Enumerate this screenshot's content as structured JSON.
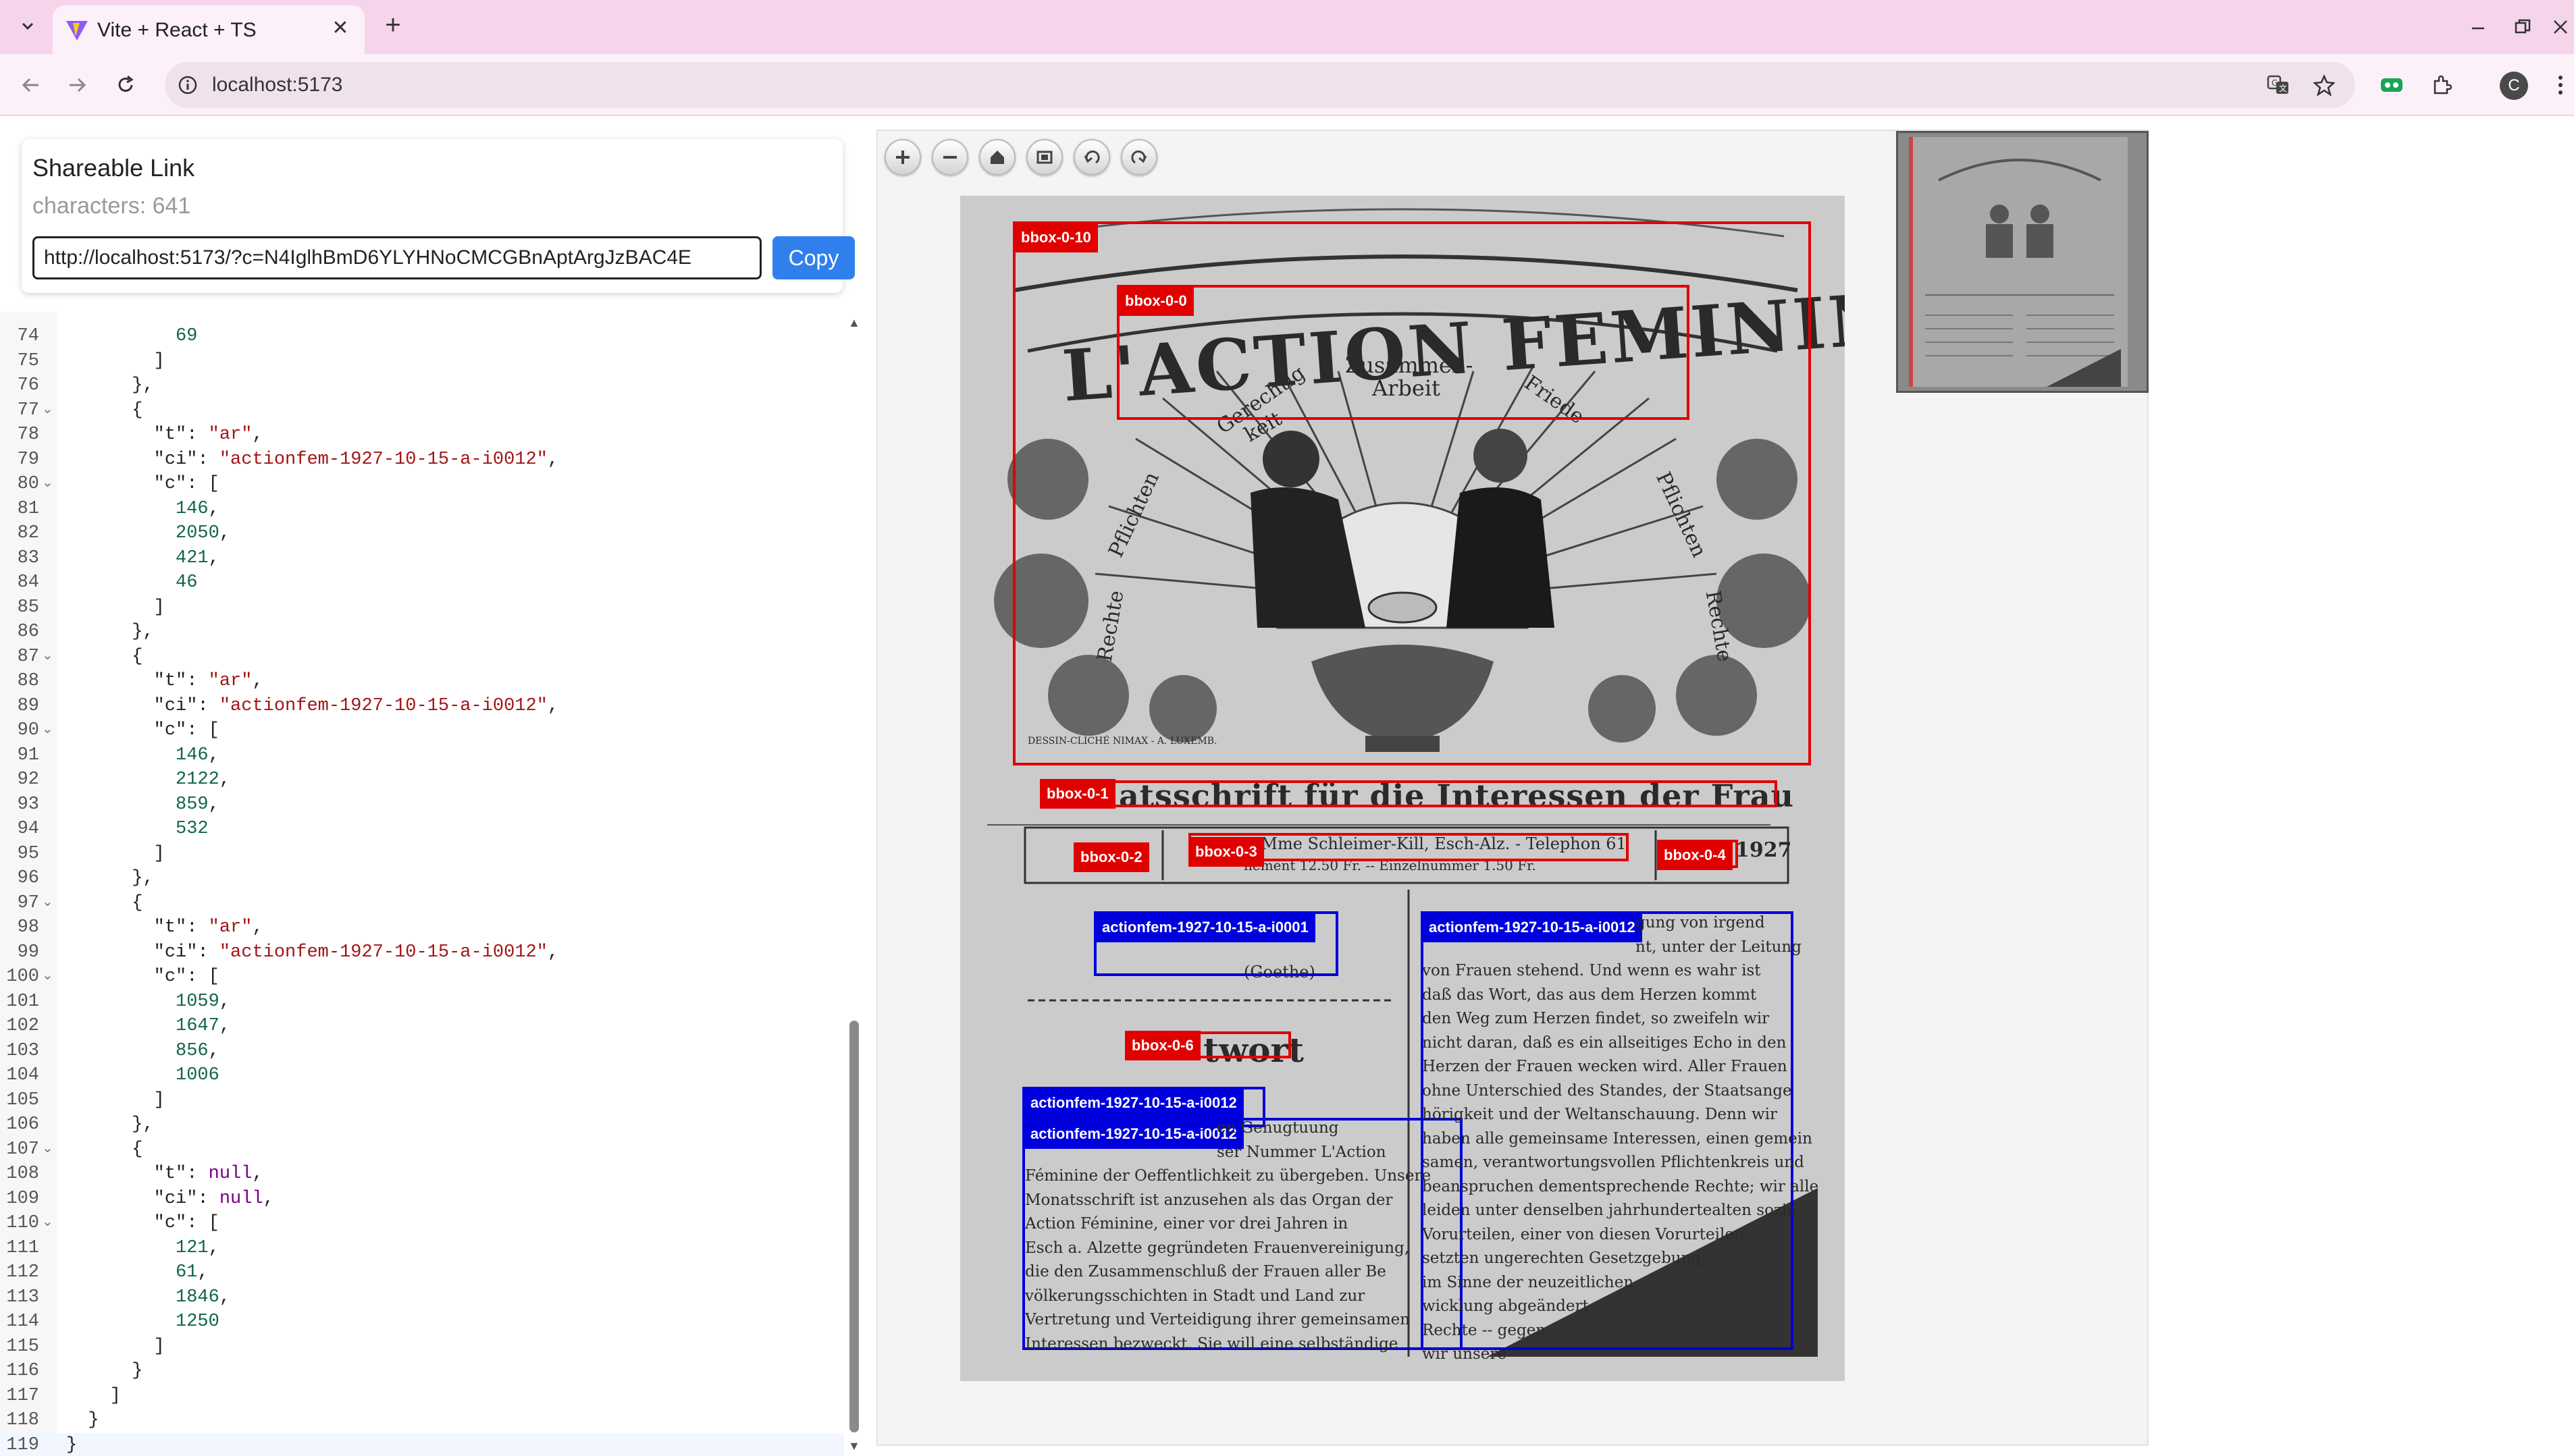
{
  "browser": {
    "tab_title": "Vite + React + TS",
    "url": "localhost:5173"
  },
  "share": {
    "title": "Shareable Link",
    "characters": "characters: 641",
    "link": "http://localhost:5173/?c=N4IglhBmD6YLYHNoCMCGBnAptArgJzBAC4E",
    "copy_label": "Copy"
  },
  "editor": {
    "lines": [
      {
        "n": "74",
        "t": "          69"
      },
      {
        "n": "75",
        "t": "        ]"
      },
      {
        "n": "76",
        "t": "      },"
      },
      {
        "n": "77",
        "t": "      {",
        "fold": true
      },
      {
        "n": "78",
        "t": "        \"t\": \"ar\","
      },
      {
        "n": "79",
        "t": "        \"ci\": \"actionfem-1927-10-15-a-i0012\","
      },
      {
        "n": "80",
        "t": "        \"c\": [",
        "fold": true
      },
      {
        "n": "81",
        "t": "          146,"
      },
      {
        "n": "82",
        "t": "          2050,"
      },
      {
        "n": "83",
        "t": "          421,"
      },
      {
        "n": "84",
        "t": "          46"
      },
      {
        "n": "85",
        "t": "        ]"
      },
      {
        "n": "86",
        "t": "      },"
      },
      {
        "n": "87",
        "t": "      {",
        "fold": true
      },
      {
        "n": "88",
        "t": "        \"t\": \"ar\","
      },
      {
        "n": "89",
        "t": "        \"ci\": \"actionfem-1927-10-15-a-i0012\","
      },
      {
        "n": "90",
        "t": "        \"c\": [",
        "fold": true
      },
      {
        "n": "91",
        "t": "          146,"
      },
      {
        "n": "92",
        "t": "          2122,"
      },
      {
        "n": "93",
        "t": "          859,"
      },
      {
        "n": "94",
        "t": "          532"
      },
      {
        "n": "95",
        "t": "        ]"
      },
      {
        "n": "96",
        "t": "      },"
      },
      {
        "n": "97",
        "t": "      {",
        "fold": true
      },
      {
        "n": "98",
        "t": "        \"t\": \"ar\","
      },
      {
        "n": "99",
        "t": "        \"ci\": \"actionfem-1927-10-15-a-i0012\","
      },
      {
        "n": "100",
        "t": "        \"c\": [",
        "fold": true
      },
      {
        "n": "101",
        "t": "          1059,"
      },
      {
        "n": "102",
        "t": "          1647,"
      },
      {
        "n": "103",
        "t": "          856,"
      },
      {
        "n": "104",
        "t": "          1006"
      },
      {
        "n": "105",
        "t": "        ]"
      },
      {
        "n": "106",
        "t": "      },"
      },
      {
        "n": "107",
        "t": "      {",
        "fold": true
      },
      {
        "n": "108",
        "t": "        \"t\": null,"
      },
      {
        "n": "109",
        "t": "        \"ci\": null,"
      },
      {
        "n": "110",
        "t": "        \"c\": [",
        "fold": true
      },
      {
        "n": "111",
        "t": "          121,"
      },
      {
        "n": "112",
        "t": "          61,"
      },
      {
        "n": "113",
        "t": "          1846,"
      },
      {
        "n": "114",
        "t": "          1250"
      },
      {
        "n": "115",
        "t": "        ]"
      },
      {
        "n": "116",
        "t": "      }"
      },
      {
        "n": "117",
        "t": "    ]"
      },
      {
        "n": "118",
        "t": "  }"
      },
      {
        "n": "119",
        "t": "}"
      }
    ]
  },
  "document": {
    "masthead_title": "L'ACTION FEMININE",
    "masthead_words": [
      "Zusammen-",
      "Arbeit",
      "Gerechtig",
      "keit",
      "Friede",
      "Pflichten",
      "Rechte",
      "Pflichten",
      "Rechte"
    ],
    "engraver": "DESSIN-CLICHÉ NIMAX - A. LUXEMB.",
    "subtitle_line": "atsschrift für die Interessen der Frau",
    "address_line": "ag: Mme Schleimer-Kill, Esch-Alz. - Telephon 61",
    "price_line": "nement 12.50 Fr. -- Einzelnummer 1.50 Fr.",
    "year": "1927",
    "quote_attrib": "(Goethe)",
    "section_word": "twort",
    "left_col": [
      "en Genugtuung",
      "ser Nummer L'Action",
      "Féminine der Oeffentlichkeit zu übergeben. Unsere",
      "Monatsschrift ist anzusehen als das Organ der",
      "Action Féminine, einer vor drei Jahren in",
      "Esch a. Alzette gegründeten Frauenvereinigung,",
      "die den Zusammenschluß der Frauen aller Be",
      "völkerungsschichten in Stadt und Land zur",
      "Vertretung und Verteidigung ihrer gemeinsamen",
      "Interessen bezweckt. Sie will eine selbständige"
    ],
    "right_col": [
      "gung von irgend",
      "nt, unter der Leitung",
      "von Frauen stehend. Und wenn es wahr ist",
      "daß das Wort, das aus dem Herzen kommt",
      "den Weg zum Herzen findet, so zweifeln wir",
      "nicht daran, daß es ein allseitiges Echo in den",
      "Herzen der Frauen wecken wird. Aller Frauen",
      "ohne Unterschied des Standes, der Staatsange",
      "hörigkeit und der Weltanschauung. Denn wir",
      "haben alle gemeinsame Interessen, einen gemein",
      "samen, verantwortungsvollen Pflichtenkreis und",
      "beanspruchen dementsprechende Rechte; wir alle",
      "leiden unter denselben jahrhundertealten sozia",
      "Vorurteilen, einer von diesen Vorurteilen",
      "setzten ungerechten Gesetzgebung,",
      "im Sinne der neuzeitlichen",
      "wicklung abgeändert",
      "Rechte -- gegen",
      "wir unsere"
    ]
  },
  "annotations": {
    "boxes": [
      {
        "label": "bbox-0-10",
        "color": "red"
      },
      {
        "label": "bbox-0-0",
        "color": "red"
      },
      {
        "label": "bbox-0-1",
        "color": "red"
      },
      {
        "label": "bbox-0-2",
        "color": "red"
      },
      {
        "label": "bbox-0-3",
        "color": "red"
      },
      {
        "label": "bbox-0-4",
        "color": "red"
      },
      {
        "label": "bbox-0-6",
        "color": "red"
      },
      {
        "label": "actionfem-1927-10-15-a-i0001",
        "color": "blue"
      },
      {
        "label": "actionfem-1927-10-15-a-i0012",
        "color": "blue"
      },
      {
        "label": "actionfem-1927-10-15-a-i0012",
        "color": "blue"
      },
      {
        "label": "actionfem-1927-10-15-a-i0012",
        "color": "blue"
      }
    ]
  },
  "colors": {
    "tab_strip": "#f5d4ec",
    "toolbar": "#fcf1f9",
    "copy_button": "#2f80ed",
    "bbox_red": "#e00000",
    "bbox_blue": "#0000dd"
  },
  "icons": {
    "tab_menu": "chevron-down-icon",
    "favicon": "vite-logo-icon",
    "tab_close": "close-icon",
    "new_tab": "plus-icon",
    "back": "arrow-left-icon",
    "forward": "arrow-right-icon",
    "reload": "reload-icon",
    "site_info": "info-icon",
    "translate": "translate-icon",
    "bookmark": "star-icon",
    "extension_1": "extension-badge-icon",
    "extensions": "puzzle-icon",
    "more": "kebab-icon",
    "zoom_in": "plus-icon",
    "zoom_out": "minus-icon",
    "home": "home-icon",
    "fullscreen": "fullscreen-icon",
    "rotate_left": "rotate-left-icon",
    "rotate_right": "rotate-right-icon"
  },
  "profile_initial": "C"
}
